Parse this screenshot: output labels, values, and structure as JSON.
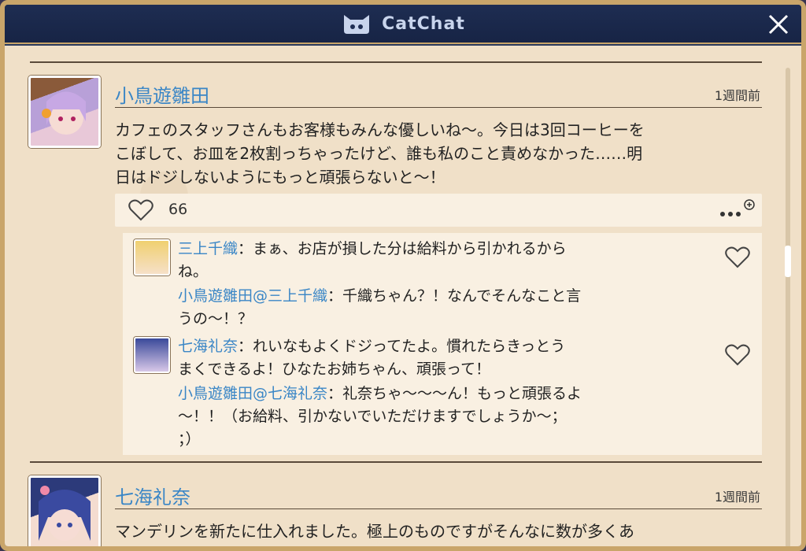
{
  "app": {
    "title": "CatChat"
  },
  "posts": [
    {
      "author": "小鳥遊雛田",
      "time": "1週間前",
      "text_lines": [
        "カフェのスタッフさんもお客様もみんな優しいね～。今日は3回コーヒーを",
        "こぼして、お皿を2枚割っちゃったけど、誰も私のこと責めなかった……明",
        "日はドジしないようにもっと頑張らないと～！"
      ],
      "likes": "66",
      "replies": [
        {
          "name": "三上千織",
          "lines": [
            "：まぁ、お店が損した分は給料から引かれるから",
            "ね。"
          ],
          "reply": {
            "name": "小鳥遊雛田@三上千織",
            "lines": [
              "：千織ちゃん？！なんでそんなこと言",
              "うの～！？"
            ]
          }
        },
        {
          "name": "七海礼奈",
          "lines": [
            "：れいなもよくドジってたよ。慣れたらきっとう",
            "まくできるよ！ひなたお姉ちゃん、頑張って！"
          ],
          "reply": {
            "name": "小鳥遊雛田@七海礼奈",
            "lines": [
              "：礼奈ちゃ～～～ん！もっと頑張るよ",
              "～！！（お給料、引かないでいただけますでしょうか～；",
              "；）"
            ]
          }
        }
      ]
    },
    {
      "author": "七海礼奈",
      "time": "1週間前",
      "text_lines": [
        "マンデリンを新たに仕入れました。極上のものですがそんなに数が多くあ"
      ]
    }
  ],
  "icons": {
    "close": "close-icon",
    "heart": "heart-icon",
    "more": "more-icon",
    "cat": "cat-logo-icon"
  },
  "colors": {
    "name": "#3a86c6",
    "panel": "#f0e0c8",
    "titlebar": "#1e2d52",
    "frame": "#c9a56a"
  }
}
